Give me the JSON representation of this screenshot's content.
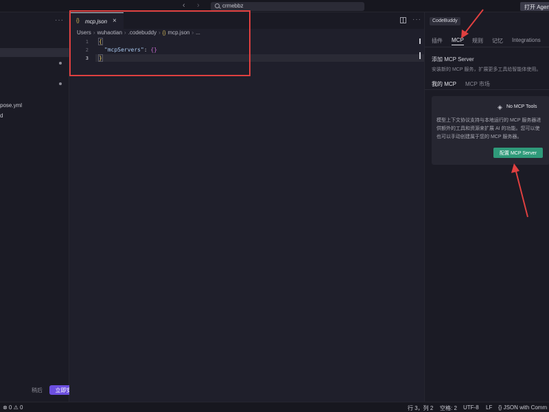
{
  "titlebar": {
    "search_value": "crmebbz",
    "open_agent_label": "打开 Agen"
  },
  "sidebar": {
    "items": [
      "pose.yml",
      "d"
    ],
    "later_label": "稍后",
    "install_label": "立即安装"
  },
  "editor": {
    "tab_label": "mcp.json",
    "breadcrumb": [
      "Users",
      "wuhaotian",
      ".codebuddy",
      "mcp.json",
      "..."
    ],
    "line_numbers": [
      "1",
      "2",
      "3"
    ],
    "code": {
      "line1": "{",
      "line2_key": "\"mcpServers\"",
      "line2_sep": ": ",
      "line2_val": "{}",
      "line3": "}"
    }
  },
  "panel": {
    "title": "CodeBuddy",
    "tabs": [
      "插件",
      "MCP",
      "规则",
      "记忆",
      "Integrations"
    ],
    "add_title": "添加 MCP Server",
    "add_desc": "安装新的 MCP 服务，扩展更多工具给智能体使用。",
    "subtabs": [
      "我的 MCP",
      "MCP 市场"
    ],
    "no_tools": "No MCP Tools",
    "card_lines": [
      "模型上下文协议支持与本地运行的 MCP 服务器进",
      "供额外的工具和资源来扩展 AI 的功能。您可以使",
      "也可以手动创建属于您的 MCP 服务器。"
    ],
    "config_button": "配置 MCP Server"
  },
  "statusbar": {
    "problems": "⊗ 0 ⚠ 0",
    "position": "行 3，列 2",
    "spaces": "空格: 2",
    "encoding": "UTF-8",
    "eol": "LF",
    "language": "{} JSON with Comm"
  },
  "colors": {
    "annotation": "#e04040",
    "install_button": "#6c4fe0",
    "config_button": "#2f9a7a",
    "json_brace": "#e0c35a"
  }
}
